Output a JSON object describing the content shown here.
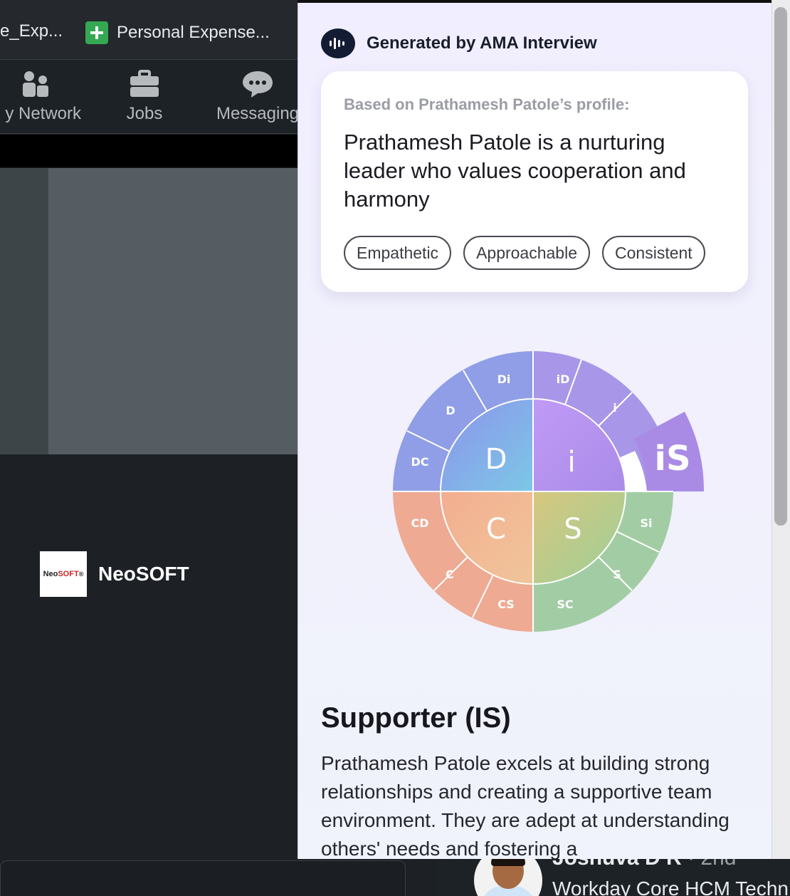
{
  "bookmarks": [
    {
      "label": "e_Exp..."
    },
    {
      "label": "Personal Expense...",
      "icon": "sheets-icon"
    }
  ],
  "nav": {
    "network": "y Network",
    "jobs": "Jobs",
    "messaging": "Messaging"
  },
  "company": {
    "logo_text_a": "Neo",
    "logo_text_b": "SOFT",
    "logo_mark": "®",
    "name": "NeoSOFT"
  },
  "person": {
    "name": "Joshuva D R",
    "degree": " · 2nd",
    "title": "Workday Core HCM Techn"
  },
  "panel": {
    "brand": "Generated by AMA Interview",
    "subtitle": "Based on Prathamesh Patole’s profile:",
    "summary": "Prathamesh Patole is a nurturing leader who values cooperation and harmony",
    "tags": [
      "Empathetic",
      "Approachable",
      "Consistent"
    ],
    "type_title": "Supporter (IS)",
    "type_desc": "Prathamesh Patole excels at building strong relationships and creating a supportive team environment. They are adept at understanding others' needs and fostering a"
  },
  "wheel": {
    "quadrants": [
      "D",
      "i",
      "S",
      "C"
    ],
    "outer_labels": [
      "iD",
      "i",
      "Si",
      "S",
      "SC",
      "CS",
      "C",
      "CD",
      "DC",
      "D",
      "Di"
    ],
    "highlight": "iS",
    "colors": {
      "D": "#8f9ee8",
      "i": "#a98ee8",
      "S": "#a3cfa5",
      "C": "#efab94",
      "highlight": "#a98be6"
    }
  }
}
